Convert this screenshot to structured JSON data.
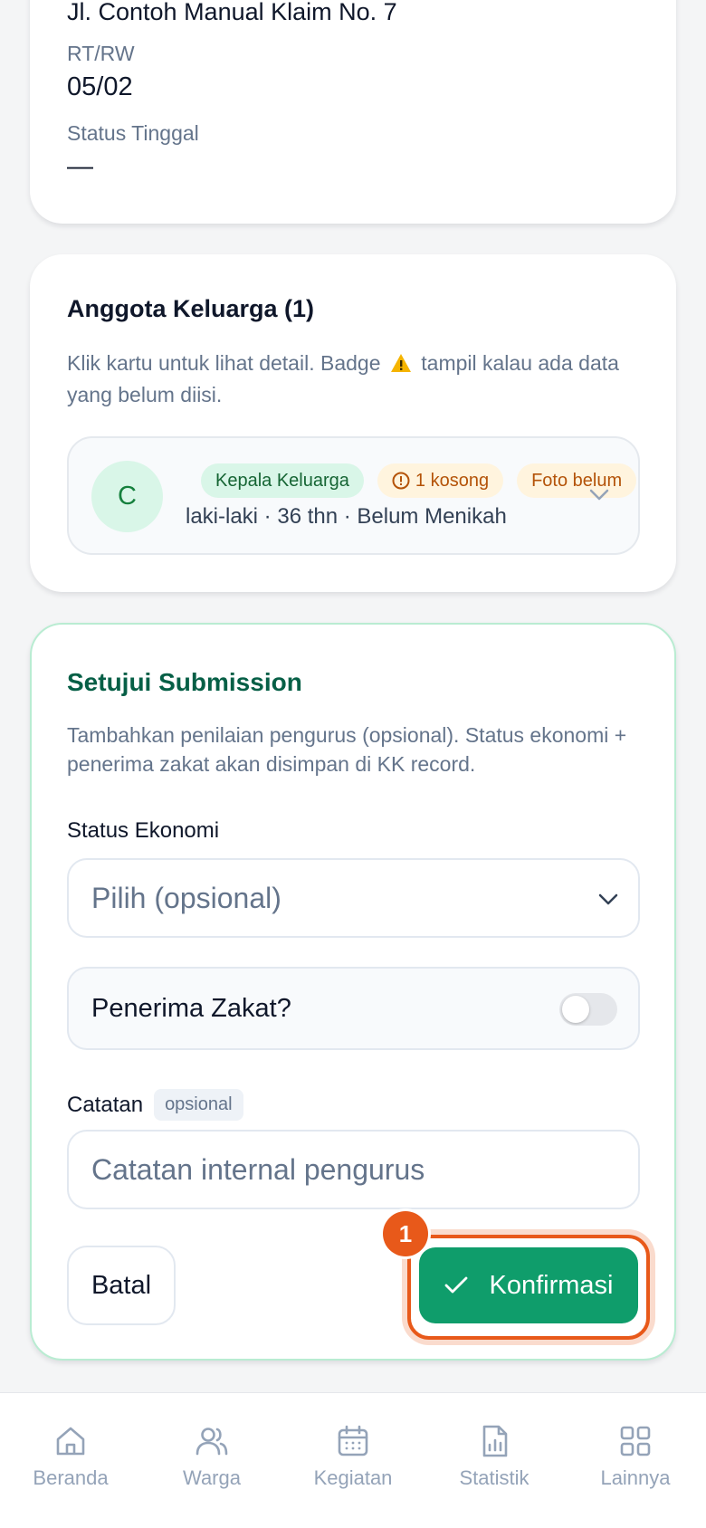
{
  "address": {
    "street": "Jl. Contoh Manual Klaim No. 7",
    "rtrw_label": "RT/RW",
    "rtrw_value": "05/02",
    "status_label": "Status Tinggal",
    "status_value": "—"
  },
  "family": {
    "title": "Anggota Keluarga (1)",
    "description_before": "Klik kartu untuk lihat detail. Badge",
    "description_after": "tampil kalau ada data yang belum diisi.",
    "members": [
      {
        "initial": "C",
        "badges": [
          "Kepala Keluarga",
          "1 kosong",
          "Foto belum"
        ],
        "meta": "laki-laki · 36 thn · Belum Menikah"
      }
    ]
  },
  "approval": {
    "title": "Setujui Submission",
    "description": "Tambahkan penilaian pengurus (opsional). Status ekonomi + penerima zakat akan disimpan di KK record.",
    "economic_label": "Status Ekonomi",
    "economic_placeholder": "Pilih (opsional)",
    "zakat_label": "Penerima Zakat?",
    "zakat_on": false,
    "note_label": "Catatan",
    "note_tag": "opsional",
    "note_placeholder": "Catatan internal pengurus",
    "cancel_label": "Batal",
    "confirm_label": "Konfirmasi",
    "step_marker": "1"
  },
  "nav": {
    "items": [
      {
        "label": "Beranda",
        "icon": "home-icon"
      },
      {
        "label": "Warga",
        "icon": "users-icon"
      },
      {
        "label": "Kegiatan",
        "icon": "calendar-icon"
      },
      {
        "label": "Statistik",
        "icon": "chart-file-icon"
      },
      {
        "label": "Lainnya",
        "icon": "grid-icon"
      }
    ]
  },
  "colors": {
    "accent_green": "#0f9d6b",
    "title_green": "#065f46",
    "highlight_orange": "#e8591a",
    "muted_text": "#64748b"
  }
}
